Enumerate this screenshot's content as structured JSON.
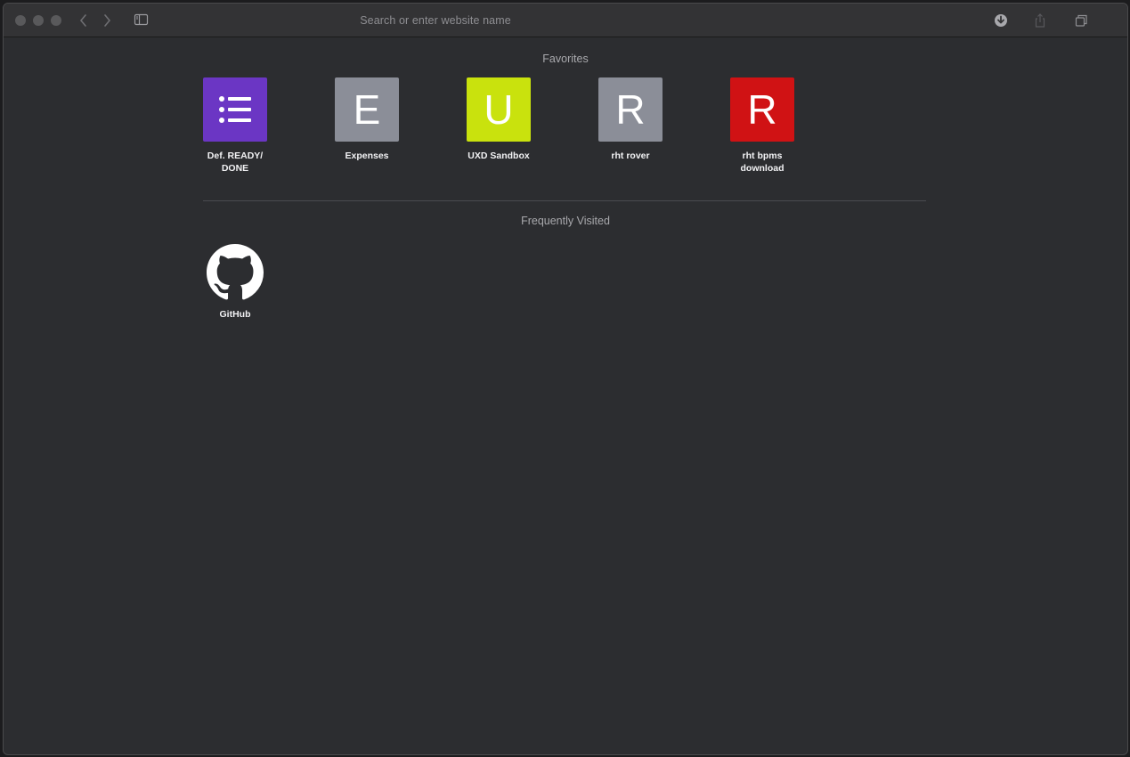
{
  "toolbar": {
    "address_placeholder": "Search or enter website name"
  },
  "favorites": {
    "title": "Favorites",
    "items": [
      {
        "label": "Def. READY/\nDONE",
        "letter": "",
        "icon": "list-icon",
        "color": "#6b36c4"
      },
      {
        "label": "Expenses",
        "letter": "E",
        "color": "#8b8e98"
      },
      {
        "label": "UXD Sandbox",
        "letter": "U",
        "color": "#c9e20d"
      },
      {
        "label": "rht rover",
        "letter": "R",
        "color": "#8b8e98"
      },
      {
        "label": "rht bpms download",
        "letter": "R",
        "color": "#d01214"
      }
    ]
  },
  "frequently_visited": {
    "title": "Frequently Visited",
    "items": [
      {
        "label": "GitHub",
        "icon": "github-icon"
      }
    ]
  }
}
